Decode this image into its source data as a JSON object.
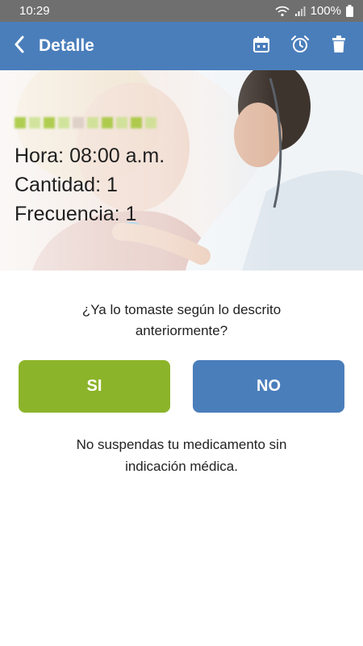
{
  "status_bar": {
    "time": "10:29",
    "battery": "100%",
    "icons": [
      "wifi-icon",
      "signal-icon",
      "battery-icon"
    ]
  },
  "app_bar": {
    "title": "Detalle",
    "icons": [
      "back-arrow-icon",
      "calendar-icon",
      "alarm-icon",
      "trash-icon"
    ],
    "color": "#4a7ebb"
  },
  "detail": {
    "hora": "Hora: 08:00 a.m.",
    "cantidad": "Cantidad: 1",
    "frecuencia": "Frecuencia: 1"
  },
  "question": {
    "line1": "¿Ya lo tomaste según lo descrito",
    "line2": "anteriormente?"
  },
  "buttons": {
    "yes_label": "SI",
    "no_label": "NO",
    "yes_color": "#8cb42a",
    "no_color": "#4a7ebb"
  },
  "warning": {
    "line1": "No suspendas tu medicamento sin",
    "line2": "indicación médica."
  }
}
